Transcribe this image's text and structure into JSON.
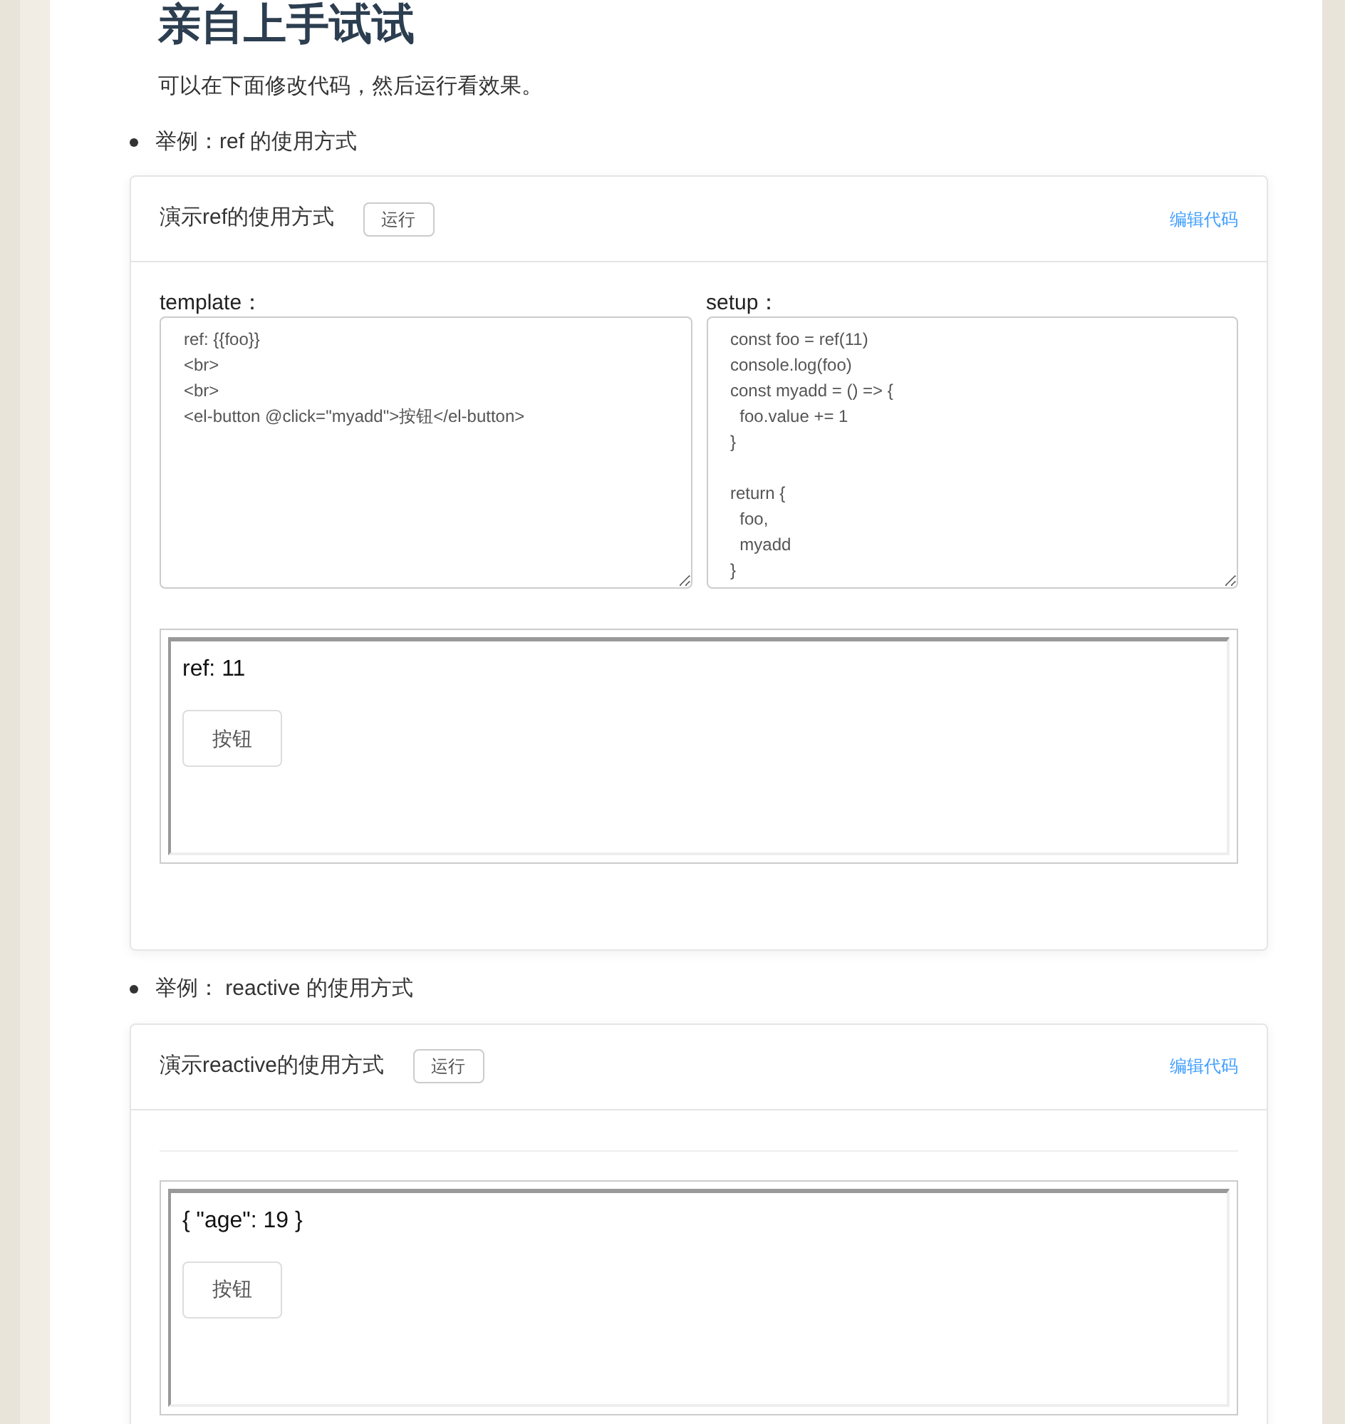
{
  "heading": "亲自上手试试",
  "intro": "可以在下面修改代码，然后运行看效果。",
  "examples": [
    {
      "bullet": "举例：ref 的使用方式",
      "demo": {
        "title": "演示ref的使用方式",
        "run_button": "运行",
        "edit_link": "编辑代码",
        "show_code": true,
        "template_label": "template：",
        "template_lines": [
          "ref: {{foo}}",
          "<br>",
          "<br>",
          "<el-button @click=\"myadd\">按钮</el-button>"
        ],
        "setup_label": "setup：",
        "setup_blocks": [
          [
            "const foo = ref(11)",
            "console.log(foo)",
            "const myadd = () => {",
            "  foo.value += 1",
            "}"
          ],
          [
            "return {",
            "  foo,",
            "  myadd",
            "}"
          ]
        ],
        "output_text": "ref: 11",
        "output_button": "按钮"
      }
    },
    {
      "bullet": "举例： reactive 的使用方式",
      "demo": {
        "title": "演示reactive的使用方式",
        "run_button": "运行",
        "edit_link": "编辑代码",
        "show_code": false,
        "output_text": "{ \"age\": 19 }",
        "output_button": "按钮"
      }
    }
  ]
}
